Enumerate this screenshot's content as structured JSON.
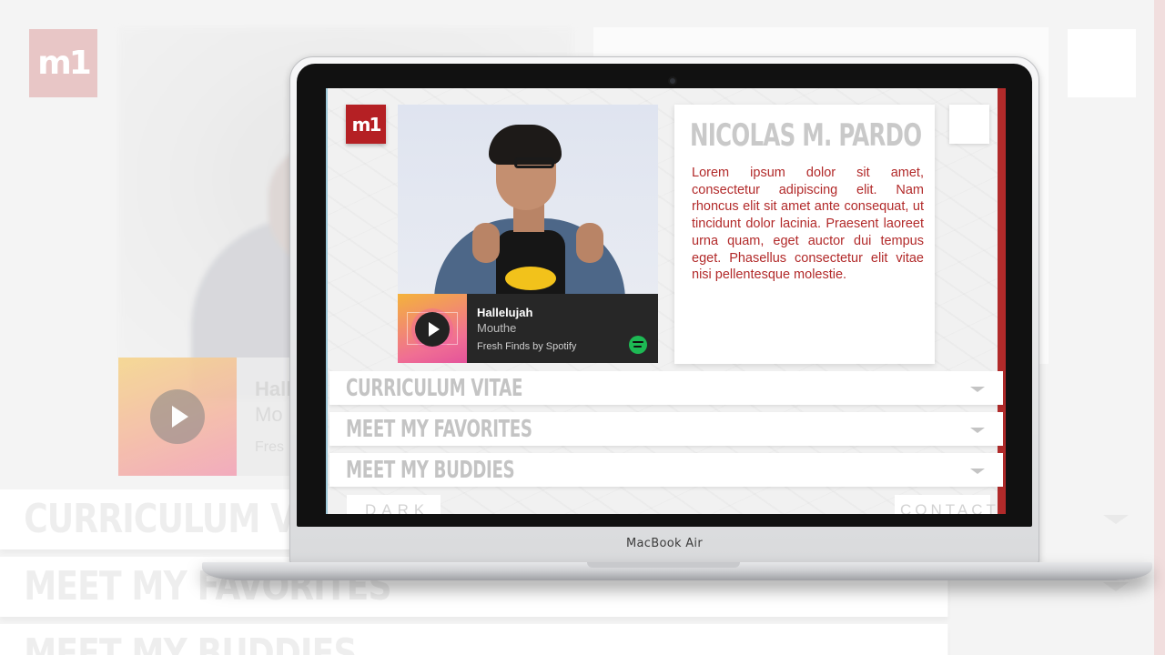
{
  "logo": {
    "text": "m1"
  },
  "profile": {
    "name": "NICOLAS M. PARDO",
    "bio": "Lorem ipsum dolor sit amet, consectetur adipiscing elit. Nam rhoncus elit sit amet ante consequat, ut tincidunt dolor lacinia. Praesent laoreet urna quam, eget auctor dui tempus eget. Phasellus consectetur elit vitae nisi pellentesque molestie."
  },
  "player": {
    "song": "Hallelujah",
    "artist": "Mouthe",
    "playlist": "Fresh Finds by Spotify",
    "icons": {
      "play": "play-icon",
      "brand": "spotify-icon"
    },
    "art_colors": [
      "#f4b33b",
      "#f06f93",
      "#e4539b"
    ]
  },
  "sections": [
    {
      "label": "CURRICULUM VITAE"
    },
    {
      "label": "MEET MY FAVORITES"
    },
    {
      "label": "MEET MY BUDDIES"
    }
  ],
  "buttons": {
    "dark": "DARK",
    "contact": "CONTACT"
  },
  "device": {
    "brand": "MacBook Air"
  },
  "background": {
    "player_song": "Hall",
    "player_artist": "Mo",
    "player_playlist": "Fres",
    "section1": "CURRICULUM VITA",
    "section2": "MEET MY FAVORITES",
    "section3": "MEET MY BUDDIES"
  },
  "colors": {
    "accent": "#b52024",
    "bio_text": "#b22a2a",
    "spotify": "#1db954"
  }
}
